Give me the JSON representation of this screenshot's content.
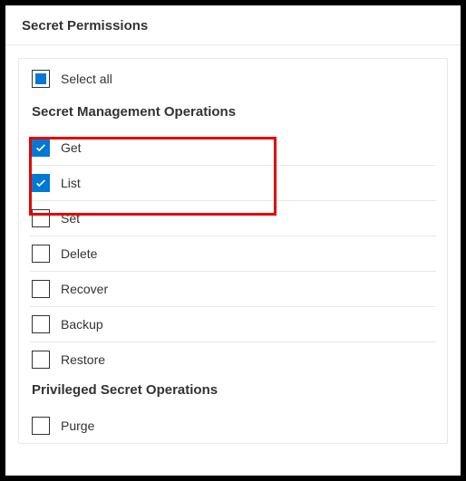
{
  "header": {
    "title": "Secret Permissions"
  },
  "select_all": {
    "label": "Select all",
    "state": "indeterminate"
  },
  "sections": [
    {
      "title": "Secret Management Operations",
      "items": [
        {
          "label": "Get",
          "checked": true
        },
        {
          "label": "List",
          "checked": true
        },
        {
          "label": "Set",
          "checked": false
        },
        {
          "label": "Delete",
          "checked": false
        },
        {
          "label": "Recover",
          "checked": false
        },
        {
          "label": "Backup",
          "checked": false
        },
        {
          "label": "Restore",
          "checked": false
        }
      ]
    },
    {
      "title": "Privileged Secret Operations",
      "items": [
        {
          "label": "Purge",
          "checked": false
        }
      ]
    }
  ],
  "highlight": {
    "color": "#e60000"
  }
}
